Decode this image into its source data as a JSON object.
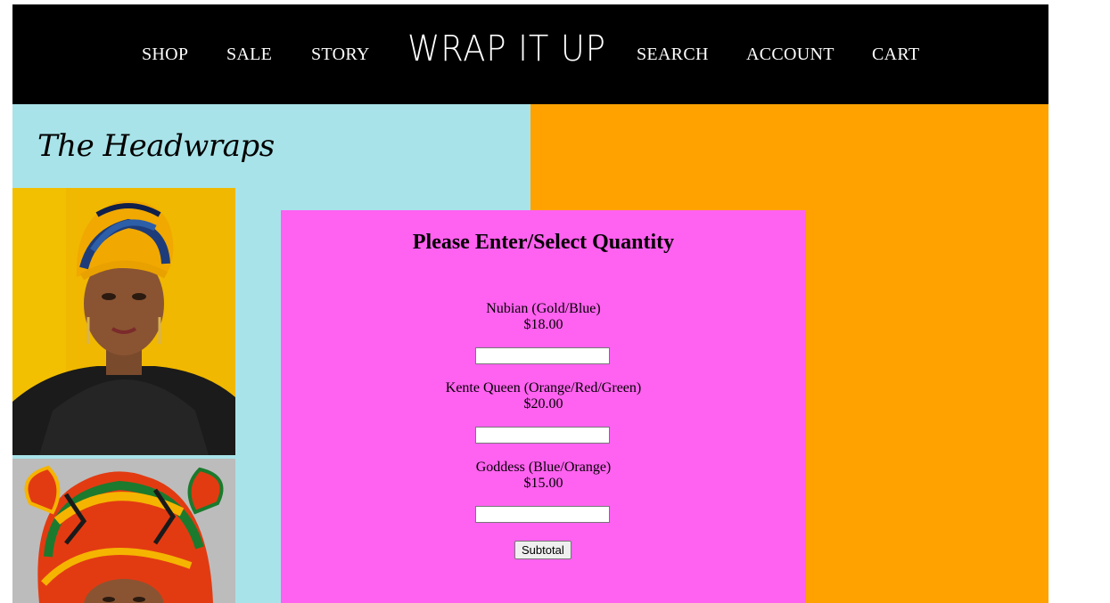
{
  "nav": {
    "left_items": [
      "SHOP",
      "SALE",
      "STORY"
    ],
    "logo": "WRAP IT UP",
    "right_items": [
      "SEARCH",
      "ACCOUNT",
      "CART"
    ]
  },
  "page": {
    "title": "The Headwraps"
  },
  "modal": {
    "heading": "Please Enter/Select Quantity",
    "products": [
      {
        "name": "Nubian (Gold/Blue)",
        "price": "$18.00",
        "quantity": ""
      },
      {
        "name": "Kente Queen (Orange/Red/Green)",
        "price": "$20.00",
        "quantity": ""
      },
      {
        "name": "Goddess (Blue/Orange)",
        "price": "$15.00",
        "quantity": ""
      }
    ],
    "subtotal_label": "Subtotal"
  },
  "colors": {
    "nav_bg": "#000000",
    "left_panel": "#a8e3e9",
    "right_panel": "#ffa200",
    "modal_bg": "#ff61f0"
  }
}
